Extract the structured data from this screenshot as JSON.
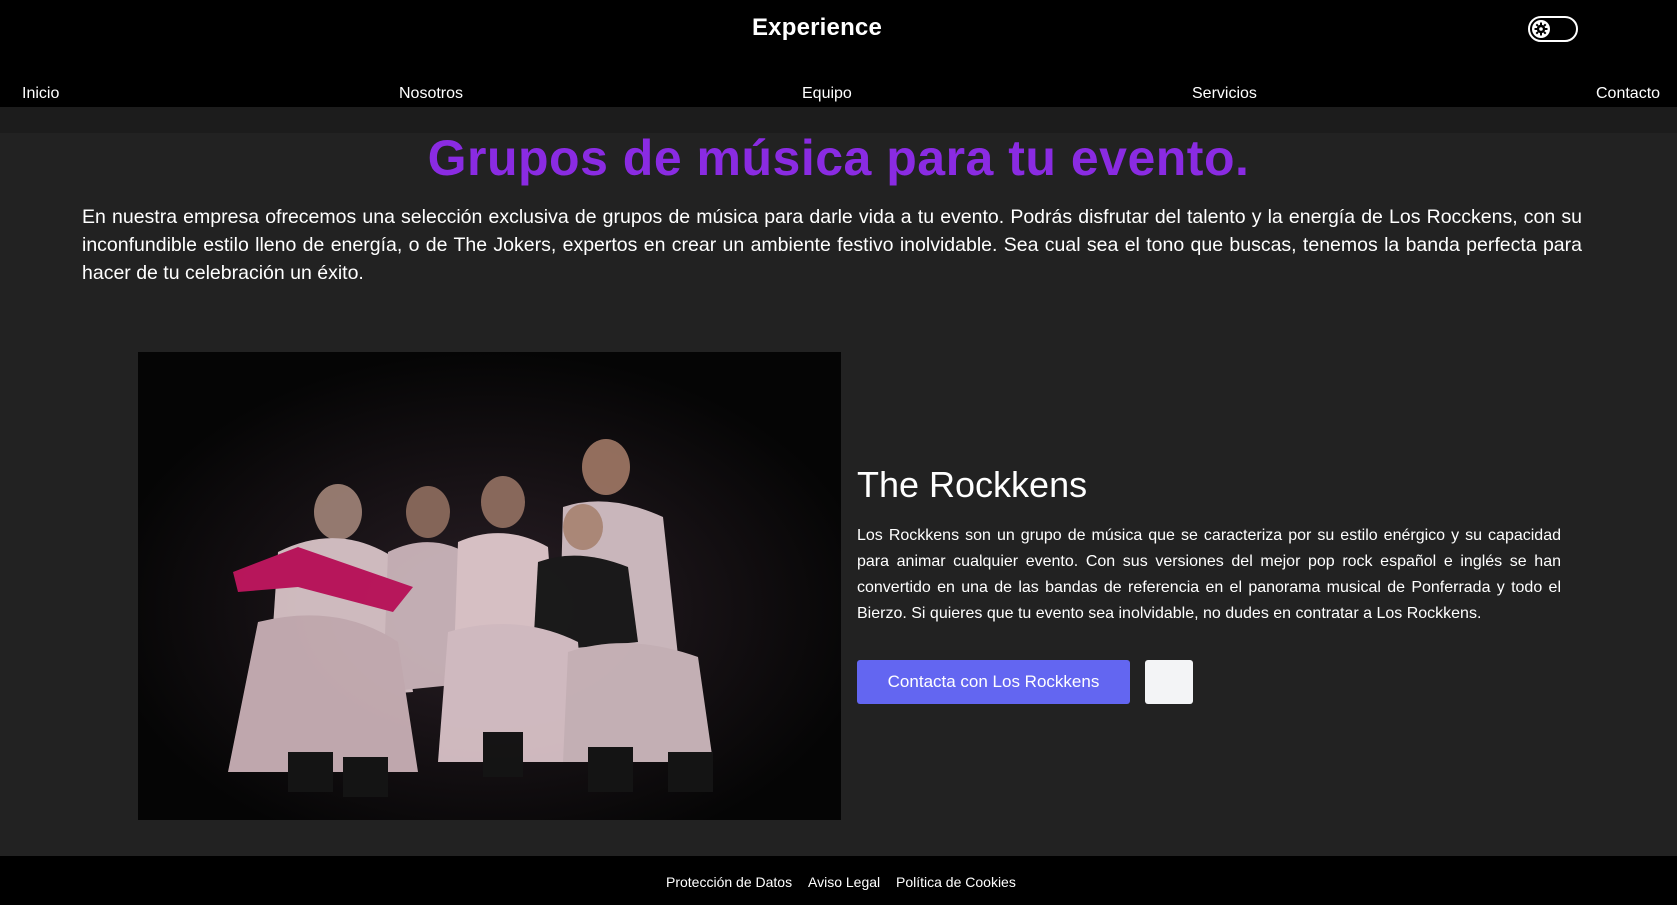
{
  "header": {
    "brand": "Experience",
    "theme_toggle_icon": "gear-icon"
  },
  "nav": {
    "items": [
      {
        "label": "Inicio"
      },
      {
        "label": "Nosotros"
      },
      {
        "label": "Equipo"
      },
      {
        "label": "Servicios"
      },
      {
        "label": "Contacto"
      }
    ]
  },
  "hero": {
    "title": "Grupos de música para tu evento.",
    "intro": "En nuestra empresa ofrecemos una selección exclusiva de grupos de música para darle vida a tu evento. Podrás disfrutar del talento y la energía de Los Rocckens, con su inconfundible estilo lleno de energía, o de The Jokers, expertos en crear un ambiente festivo inolvidable. Sea cual sea el tono que buscas, tenemos la banda perfecta para hacer de tu celebración un éxito."
  },
  "band": {
    "name": "The Rockkens",
    "description": "Los Rockkens son un grupo de música que se caracteriza por su estilo enérgico y su capacidad para animar cualquier evento. Con sus versiones del mejor pop rock español e inglés se han convertido en una de las bandas de referencia en el panorama musical de Ponferrada y todo el Bierzo. Si quieres que tu evento sea inolvidable, no dudes en contratar a Los Rockkens.",
    "contact_label": "Contacta con Los Rockkens"
  },
  "footer": {
    "links": [
      {
        "label": "Protección de Datos"
      },
      {
        "label": "Aviso Legal"
      },
      {
        "label": "Política de Cookies"
      }
    ]
  },
  "colors": {
    "accent": "#8a2be2",
    "button": "#6366f1",
    "background": "#222222",
    "header": "#000000"
  }
}
